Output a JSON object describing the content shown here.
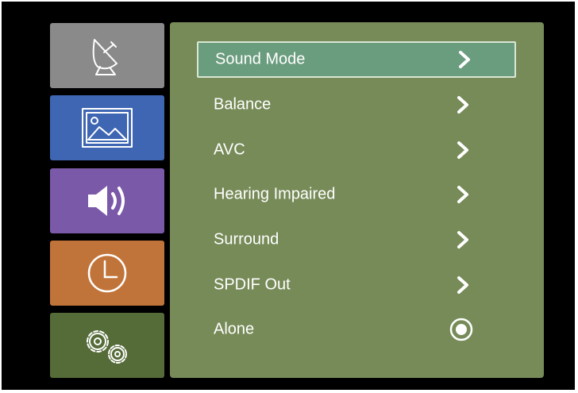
{
  "tabs": [
    {
      "name": "channel",
      "icon": "satellite-dish-icon",
      "color": "#8a8a8a"
    },
    {
      "name": "picture",
      "icon": "picture-icon",
      "color": "#3f66b3"
    },
    {
      "name": "sound",
      "icon": "speaker-icon",
      "color": "#7b59a9",
      "active": true
    },
    {
      "name": "time",
      "icon": "clock-icon",
      "color": "#c1743a"
    },
    {
      "name": "setup",
      "icon": "gears-icon",
      "color": "#556b38"
    }
  ],
  "menu": {
    "panel_color": "#778b58",
    "selected_color": "#6a9c7e",
    "items": [
      {
        "label": "Sound Mode",
        "control": "chevron-right-icon",
        "selected": true
      },
      {
        "label": "Balance",
        "control": "chevron-right-icon"
      },
      {
        "label": "AVC",
        "control": "chevron-right-icon"
      },
      {
        "label": "Hearing Impaired",
        "control": "chevron-right-icon"
      },
      {
        "label": "Surround",
        "control": "chevron-right-icon"
      },
      {
        "label": "SPDIF Out",
        "control": "chevron-right-icon"
      },
      {
        "label": "Alone",
        "control": "radio-selected-icon"
      }
    ]
  }
}
